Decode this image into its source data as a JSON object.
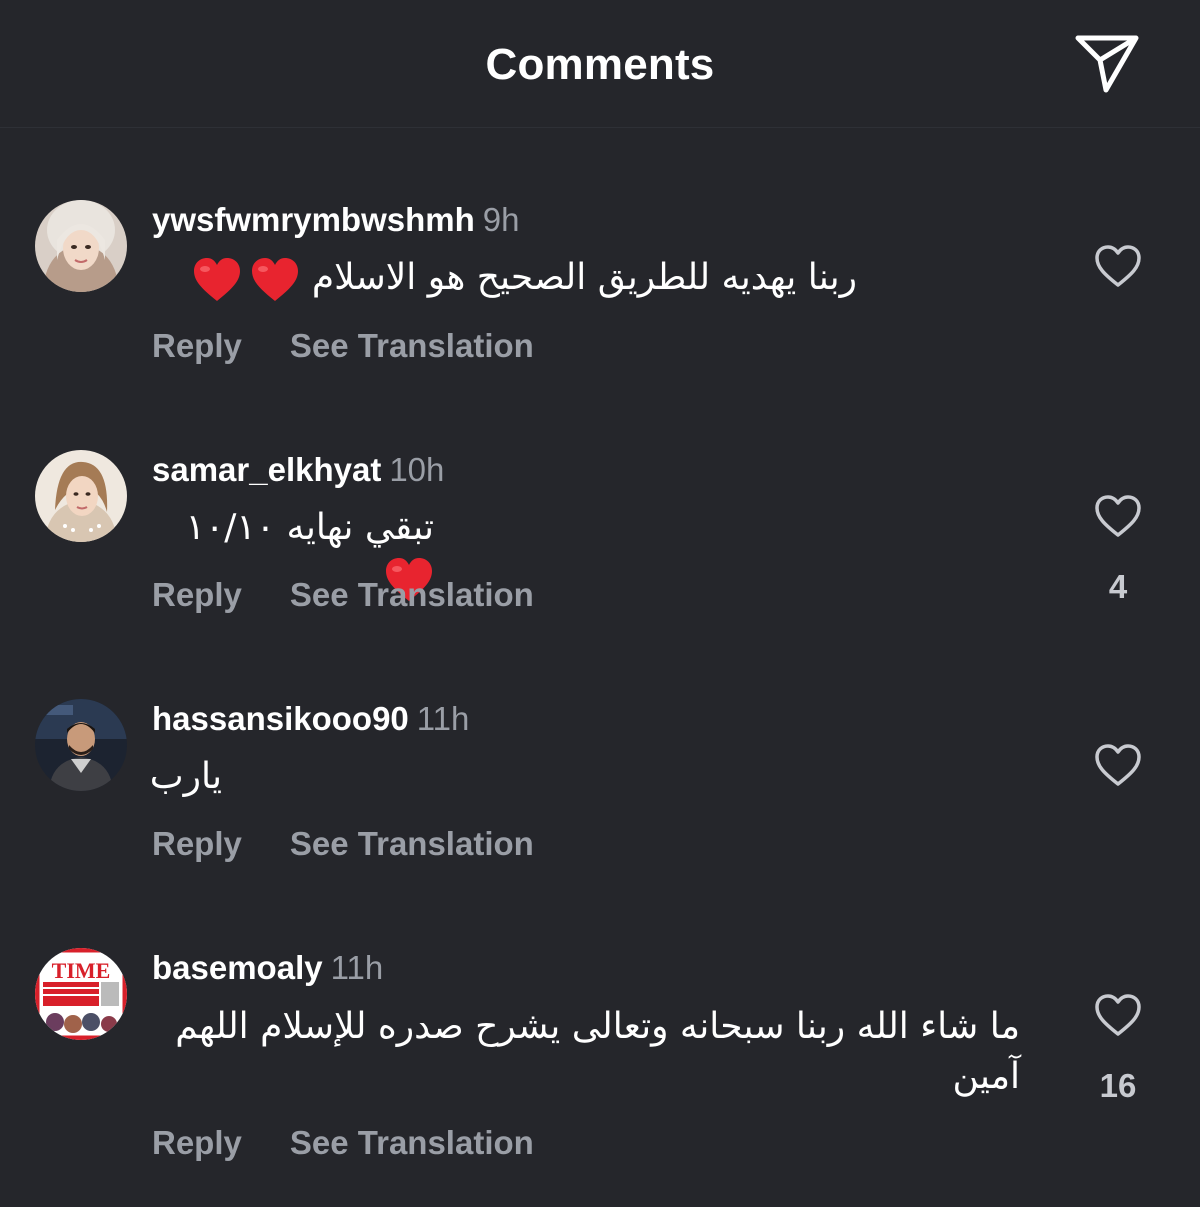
{
  "header": {
    "title": "Comments",
    "share_icon": "paper-plane-icon"
  },
  "colors": {
    "background": "#25262b",
    "primary_text": "#ffffff",
    "secondary_text": "#9a9ea6",
    "heart_red": "#e8242f"
  },
  "comments": [
    {
      "username": "ywsfwmrymbwshmh",
      "time": "9h",
      "text": "ربنا يهديه للطريق الصحيح هو الاسلام",
      "emoji": "❤️❤️",
      "reply": "Reply",
      "see_translation": "See Translation",
      "like_count": ""
    },
    {
      "username": "samar_elkhyat",
      "time": "10h",
      "text": "تبقي نهايه ١٠/١٠",
      "emoji": "❤️",
      "reply": "Reply",
      "see_translation": "See Translation",
      "like_count": "4"
    },
    {
      "username": "hassansikooo90",
      "time": "11h",
      "text": "يارب",
      "reply": "Reply",
      "see_translation": "See Translation",
      "like_count": ""
    },
    {
      "username": "basemoaly",
      "time": "11h",
      "text": "ما شاء الله ربنا سبحانه وتعالى يشرح صدره للإسلام اللهم آمين",
      "avatar_text": "TIME",
      "reply": "Reply",
      "see_translation": "See Translation",
      "like_count": "16"
    }
  ]
}
